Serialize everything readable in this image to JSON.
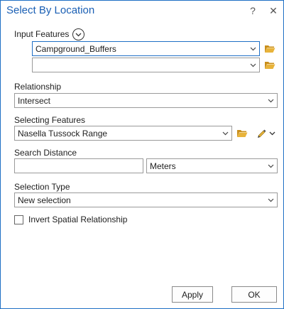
{
  "window": {
    "title": "Select By Location",
    "help_label": "?",
    "close_label": "✕"
  },
  "input_features": {
    "label": "Input Features",
    "rows": [
      {
        "value": "Campground_Buffers"
      },
      {
        "value": ""
      }
    ]
  },
  "relationship": {
    "label": "Relationship",
    "value": "Intersect"
  },
  "selecting_features": {
    "label": "Selecting Features",
    "value": "Nasella Tussock Range"
  },
  "search_distance": {
    "label": "Search Distance",
    "value": "",
    "unit": "Meters"
  },
  "selection_type": {
    "label": "Selection Type",
    "value": "New selection"
  },
  "invert": {
    "label": "Invert Spatial Relationship",
    "checked": false
  },
  "buttons": {
    "apply": "Apply",
    "ok": "OK"
  },
  "colors": {
    "accent": "#1f6fc5",
    "folder": "#e8b33a"
  }
}
